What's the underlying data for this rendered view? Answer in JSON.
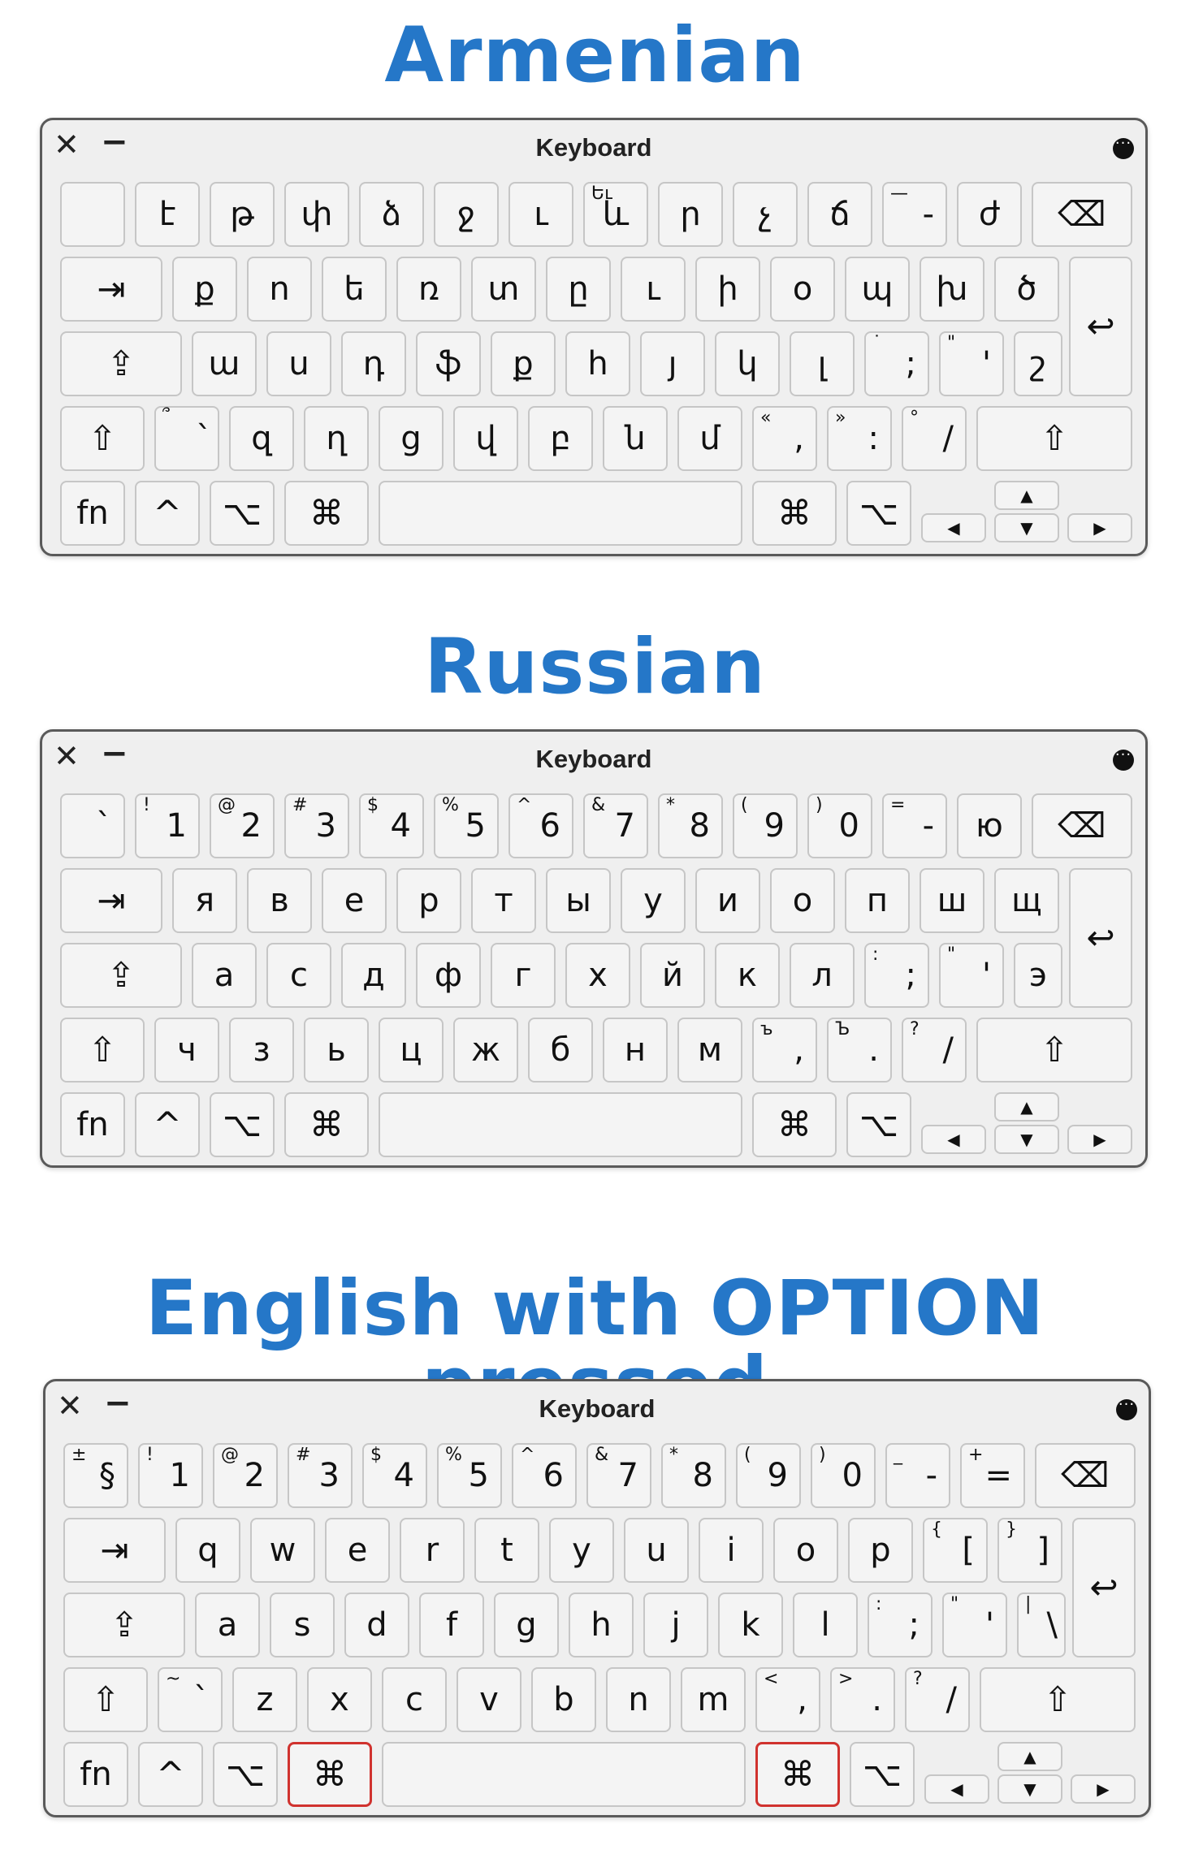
{
  "titles": {
    "armenian": "Armenian",
    "russian": "Russian",
    "english": "English with OPTION pressed"
  },
  "window": {
    "title": "Keyboard",
    "close_icon": "✕",
    "minimize_icon": "−",
    "more_icon": "•••"
  },
  "keys": {
    "fn": "fn",
    "control": "^",
    "option": "⌥",
    "command": "⌘",
    "tab": "⇥",
    "capslock": "⇪",
    "shift": "⇧",
    "delete": "⌫",
    "return": "↩",
    "arrow_up": "▲",
    "arrow_down": "▼",
    "arrow_left": "◀",
    "arrow_right": "▶"
  },
  "armenian": {
    "row1": [
      {
        "m": "",
        "s": ""
      },
      {
        "m": "է",
        "s": ""
      },
      {
        "m": "թ",
        "s": ""
      },
      {
        "m": "փ",
        "s": ""
      },
      {
        "m": "ձ",
        "s": ""
      },
      {
        "m": "ջ",
        "s": ""
      },
      {
        "m": "ւ",
        "s": ""
      },
      {
        "m": "և",
        "s": "Եւ"
      },
      {
        "m": "ր",
        "s": ""
      },
      {
        "m": "չ",
        "s": ""
      },
      {
        "m": "ճ",
        "s": ""
      },
      {
        "m": "-",
        "s": "—"
      },
      {
        "m": "ժ",
        "s": ""
      }
    ],
    "row2": [
      "ք",
      "ո",
      "ե",
      "ռ",
      "տ",
      "ը",
      "ւ",
      "ի",
      "օ",
      "պ",
      "խ",
      "ծ"
    ],
    "row3": [
      {
        "m": "ա",
        "s": ""
      },
      {
        "m": "ս",
        "s": ""
      },
      {
        "m": "դ",
        "s": ""
      },
      {
        "m": "ֆ",
        "s": ""
      },
      {
        "m": "ք",
        "s": ""
      },
      {
        "m": "հ",
        "s": ""
      },
      {
        "m": "յ",
        "s": ""
      },
      {
        "m": "կ",
        "s": ""
      },
      {
        "m": "լ",
        "s": ""
      },
      {
        "m": ";",
        "s": "˙"
      },
      {
        "m": "'",
        "s": "\""
      },
      {
        "m": "շ",
        "s": ""
      }
    ],
    "row4": [
      {
        "m": "՝",
        "s": "՞"
      },
      {
        "m": "զ",
        "s": ""
      },
      {
        "m": "ղ",
        "s": ""
      },
      {
        "m": "ց",
        "s": ""
      },
      {
        "m": "վ",
        "s": ""
      },
      {
        "m": "բ",
        "s": ""
      },
      {
        "m": "ն",
        "s": ""
      },
      {
        "m": "մ",
        "s": ""
      },
      {
        "m": ",",
        "s": "«"
      },
      {
        "m": ":",
        "s": "»"
      },
      {
        "m": "/",
        "s": "°"
      }
    ]
  },
  "russian": {
    "row1": [
      {
        "m": "`",
        "s": ""
      },
      {
        "m": "1",
        "s": "!"
      },
      {
        "m": "2",
        "s": "@"
      },
      {
        "m": "3",
        "s": "#"
      },
      {
        "m": "4",
        "s": "$"
      },
      {
        "m": "5",
        "s": "%"
      },
      {
        "m": "6",
        "s": "^"
      },
      {
        "m": "7",
        "s": "&"
      },
      {
        "m": "8",
        "s": "*"
      },
      {
        "m": "9",
        "s": "("
      },
      {
        "m": "0",
        "s": ")"
      },
      {
        "m": "-",
        "s": "="
      },
      {
        "m": "ю",
        "s": ""
      }
    ],
    "row2": [
      "я",
      "в",
      "е",
      "р",
      "т",
      "ы",
      "у",
      "и",
      "о",
      "п",
      "ш",
      "щ"
    ],
    "row3": [
      {
        "m": "а",
        "s": ""
      },
      {
        "m": "с",
        "s": ""
      },
      {
        "m": "д",
        "s": ""
      },
      {
        "m": "ф",
        "s": ""
      },
      {
        "m": "г",
        "s": ""
      },
      {
        "m": "х",
        "s": ""
      },
      {
        "m": "й",
        "s": ""
      },
      {
        "m": "к",
        "s": ""
      },
      {
        "m": "л",
        "s": ""
      },
      {
        "m": ";",
        "s": ":"
      },
      {
        "m": "'",
        "s": "\""
      },
      {
        "m": "э",
        "s": ""
      }
    ],
    "row4": [
      {
        "m": "ч",
        "s": ""
      },
      {
        "m": "з",
        "s": ""
      },
      {
        "m": "ь",
        "s": ""
      },
      {
        "m": "ц",
        "s": ""
      },
      {
        "m": "ж",
        "s": ""
      },
      {
        "m": "б",
        "s": ""
      },
      {
        "m": "н",
        "s": ""
      },
      {
        "m": "м",
        "s": ""
      },
      {
        "m": ",",
        "s": "ъ"
      },
      {
        "m": ".",
        "s": "Ъ"
      },
      {
        "m": "/",
        "s": "?"
      }
    ]
  },
  "english": {
    "row1": [
      {
        "m": "§",
        "s": "±"
      },
      {
        "m": "1",
        "s": "!"
      },
      {
        "m": "2",
        "s": "@"
      },
      {
        "m": "3",
        "s": "#"
      },
      {
        "m": "4",
        "s": "$"
      },
      {
        "m": "5",
        "s": "%"
      },
      {
        "m": "6",
        "s": "^"
      },
      {
        "m": "7",
        "s": "&"
      },
      {
        "m": "8",
        "s": "*"
      },
      {
        "m": "9",
        "s": "("
      },
      {
        "m": "0",
        "s": ")"
      },
      {
        "m": "-",
        "s": "_"
      },
      {
        "m": "=",
        "s": "+"
      }
    ],
    "row2": [
      {
        "m": "q",
        "s": ""
      },
      {
        "m": "w",
        "s": ""
      },
      {
        "m": "e",
        "s": ""
      },
      {
        "m": "r",
        "s": ""
      },
      {
        "m": "t",
        "s": ""
      },
      {
        "m": "y",
        "s": ""
      },
      {
        "m": "u",
        "s": ""
      },
      {
        "m": "i",
        "s": ""
      },
      {
        "m": "o",
        "s": ""
      },
      {
        "m": "p",
        "s": ""
      },
      {
        "m": "[",
        "s": "{"
      },
      {
        "m": "]",
        "s": "}"
      }
    ],
    "row3": [
      {
        "m": "a",
        "s": ""
      },
      {
        "m": "s",
        "s": ""
      },
      {
        "m": "d",
        "s": ""
      },
      {
        "m": "f",
        "s": ""
      },
      {
        "m": "g",
        "s": ""
      },
      {
        "m": "h",
        "s": ""
      },
      {
        "m": "j",
        "s": ""
      },
      {
        "m": "k",
        "s": ""
      },
      {
        "m": "l",
        "s": ""
      },
      {
        "m": ";",
        "s": ":"
      },
      {
        "m": "'",
        "s": "\""
      },
      {
        "m": "\\",
        "s": "|"
      }
    ],
    "row4": [
      {
        "m": "`",
        "s": "~"
      },
      {
        "m": "z",
        "s": ""
      },
      {
        "m": "x",
        "s": ""
      },
      {
        "m": "c",
        "s": ""
      },
      {
        "m": "v",
        "s": ""
      },
      {
        "m": "b",
        "s": ""
      },
      {
        "m": "n",
        "s": ""
      },
      {
        "m": "m",
        "s": ""
      },
      {
        "m": ",",
        "s": "<"
      },
      {
        "m": ".",
        "s": ">"
      },
      {
        "m": "/",
        "s": "?"
      }
    ]
  },
  "highlight_color": "#d0322e",
  "title_color": "#2577c8"
}
